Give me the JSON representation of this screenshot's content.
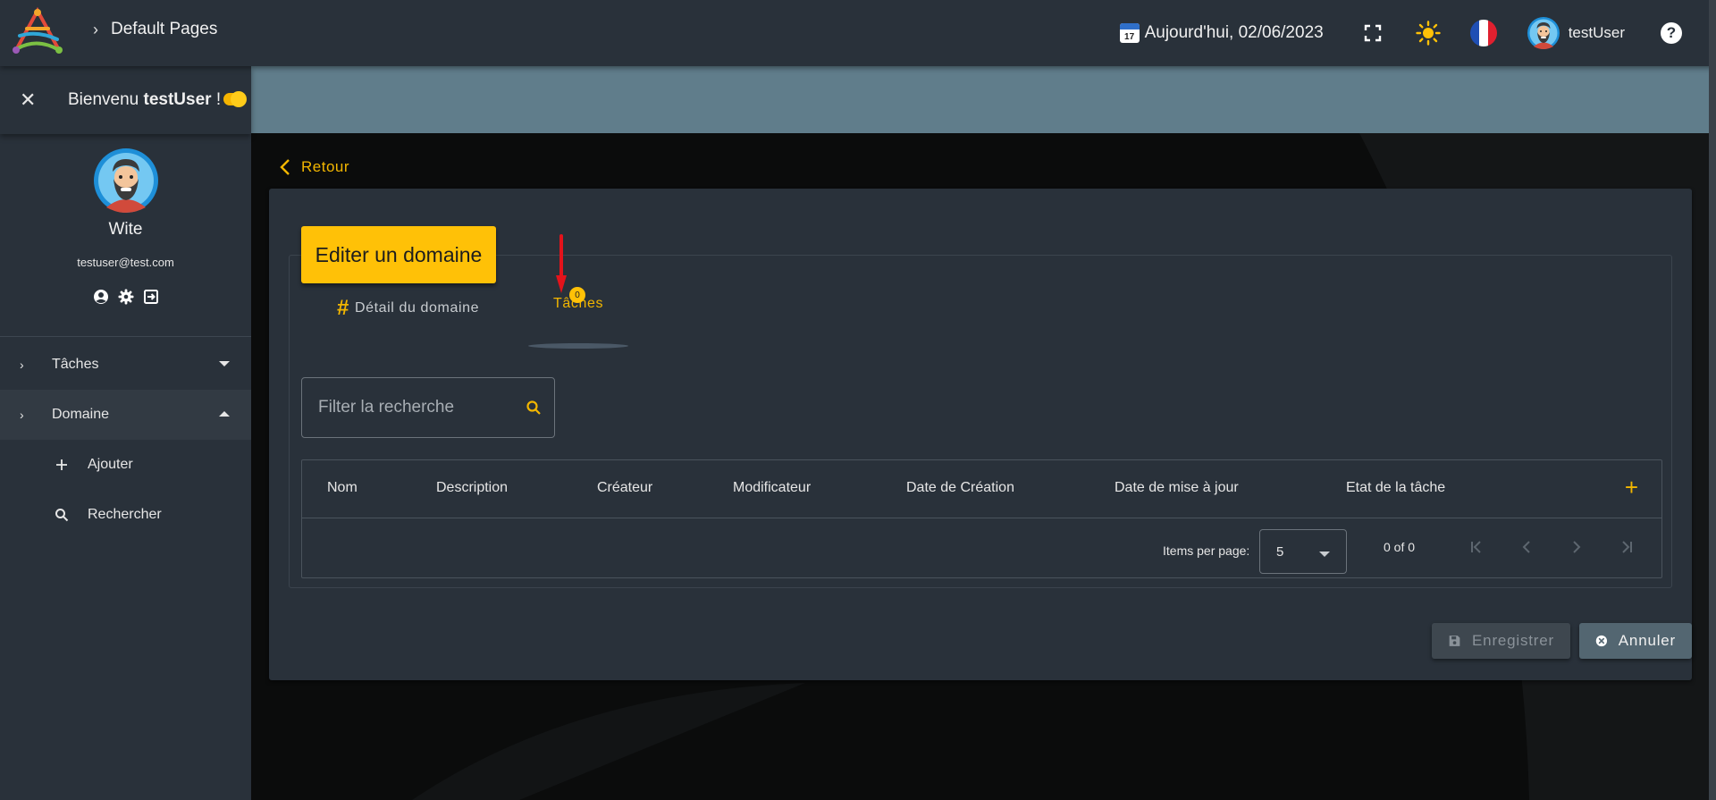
{
  "header": {
    "breadcrumb": "Default Pages",
    "date_text": "Aujourd'hui, 02/06/2023",
    "calendar_day": "17",
    "username": "testUser",
    "help_label": "?"
  },
  "sidebar": {
    "welcome_prefix": "Bienvenu ",
    "welcome_user": "testUser",
    "welcome_suffix": " !",
    "profile_name": "Wite",
    "profile_email": "testuser@test.com",
    "menu": [
      {
        "label": "Tâches",
        "expanded": false
      },
      {
        "label": "Domaine",
        "expanded": true
      }
    ],
    "submenu": [
      {
        "label": "Ajouter",
        "icon": "plus-icon"
      },
      {
        "label": "Rechercher",
        "icon": "search-icon"
      }
    ]
  },
  "main": {
    "back_label": "Retour",
    "card_title": "Editer un domaine",
    "tabs": [
      {
        "label": "Détail du domaine",
        "active": false
      },
      {
        "label": "Tâches",
        "active": true,
        "badge": "0"
      }
    ],
    "search_placeholder": "Filter la recherche",
    "table": {
      "columns": [
        "Nom",
        "Description",
        "Créateur",
        "Modificateur",
        "Date de Création",
        "Date de mise à jour",
        "Etat de la tâche"
      ],
      "add_label": "+",
      "items_per_page_label": "Items per page:",
      "items_per_page": "5",
      "range_label": "0 of 0"
    },
    "buttons": {
      "save": "Enregistrer",
      "cancel": "Annuler"
    }
  },
  "colors": {
    "accent": "#ffc107",
    "topbar": "#29313a",
    "banner": "#607d8b",
    "annotation_arrow": "#e3131b"
  }
}
